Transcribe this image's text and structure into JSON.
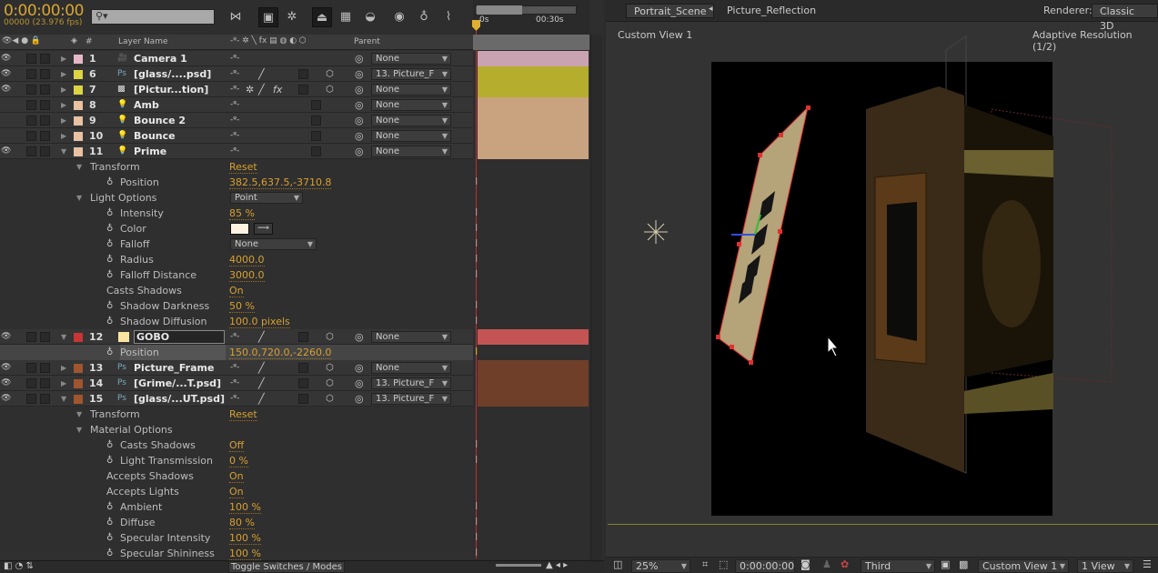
{
  "timeline": {
    "timecode": "0:00:00:00",
    "frame_fps": "00000 (23.976 fps)",
    "search_placeholder": "",
    "ruler_labels": [
      "0s",
      "00:30s"
    ],
    "headers": {
      "layer_name": "Layer Name",
      "number": "#",
      "parent": "Parent"
    },
    "toggle_label": "Toggle Switches / Modes",
    "rows": [
      {
        "type": "layer",
        "num": "1",
        "name": "Camera 1",
        "icon": "camera-icon",
        "color": "#e6b8c8",
        "bar": "#c9a3b1",
        "eye": true,
        "parent": "None",
        "expanded": false
      },
      {
        "type": "layer",
        "num": "6",
        "name": "[glass/....psd]",
        "icon": "psd-icon",
        "color": "#dcd443",
        "bar": "#b5ad2e",
        "eye": true,
        "parent": "13. Picture_F",
        "expanded": false
      },
      {
        "type": "layer",
        "num": "7",
        "name": "[Pictur...tion]",
        "icon": "precomp-icon",
        "color": "#dcd443",
        "bar": "#b5ad2e",
        "eye": true,
        "parent": "None",
        "expanded": false,
        "fx": true
      },
      {
        "type": "layer",
        "num": "8",
        "name": "Amb",
        "icon": "light-icon",
        "color": "#e8c2a2",
        "bar": "#c9a27f",
        "eye": false,
        "parent": "None",
        "expanded": false
      },
      {
        "type": "layer",
        "num": "9",
        "name": "Bounce 2",
        "icon": "light-icon",
        "color": "#e8c2a2",
        "bar": "#c9a27f",
        "eye": false,
        "parent": "None",
        "expanded": false
      },
      {
        "type": "layer",
        "num": "10",
        "name": "Bounce",
        "icon": "light-icon",
        "color": "#e8c2a2",
        "bar": "#c9a27f",
        "eye": false,
        "parent": "None",
        "expanded": false
      },
      {
        "type": "layer",
        "num": "11",
        "name": "Prime",
        "icon": "light-icon",
        "color": "#e8c2a2",
        "bar": "#c9a27f",
        "eye": true,
        "parent": "None",
        "expanded": true
      },
      {
        "type": "group",
        "label": "Transform",
        "value": "Reset"
      },
      {
        "type": "prop",
        "label": "Position",
        "value": "382.5,637.5,-3710.8",
        "kf": true
      },
      {
        "type": "group",
        "label": "Light Options",
        "value": "Point",
        "dropdown": true
      },
      {
        "type": "prop",
        "label": "Intensity",
        "value": "85 %",
        "kf": true
      },
      {
        "type": "prop",
        "label": "Color",
        "value": "",
        "swatch": "#fdf3e0",
        "kf": true
      },
      {
        "type": "prop",
        "label": "Falloff",
        "value": "None",
        "dropdown": true,
        "kf": true
      },
      {
        "type": "prop",
        "label": "Radius",
        "value": "4000.0",
        "kf": true
      },
      {
        "type": "prop",
        "label": "Falloff Distance",
        "value": "3000.0",
        "kf": true
      },
      {
        "type": "prop",
        "label": "Casts Shadows",
        "value": "On",
        "nostop": true
      },
      {
        "type": "prop",
        "label": "Shadow Darkness",
        "value": "50 %",
        "kf": true
      },
      {
        "type": "prop",
        "label": "Shadow Diffusion",
        "value": "100.0 pixels",
        "kf": true
      },
      {
        "type": "layer",
        "num": "12",
        "name": "GOBO",
        "icon": "solid-icon",
        "color": "#c83535",
        "bar": "#c45454",
        "eye": true,
        "parent": "None",
        "expanded": true,
        "editing": true
      },
      {
        "type": "prop",
        "label": "Position",
        "value": "150.0,720.0,-2260.0",
        "kf": true,
        "selected": true
      },
      {
        "type": "layer",
        "num": "13",
        "name": "Picture_Frame",
        "icon": "psd-icon",
        "color": "#a0552e",
        "bar": "#6f3f2a",
        "eye": true,
        "parent": "None",
        "expanded": false
      },
      {
        "type": "layer",
        "num": "14",
        "name": "[Grime/...T.psd]",
        "icon": "psd-icon",
        "color": "#a0552e",
        "bar": "#6f3f2a",
        "eye": true,
        "parent": "13. Picture_F",
        "expanded": false
      },
      {
        "type": "layer",
        "num": "15",
        "name": "[glass/...UT.psd]",
        "icon": "psd-icon",
        "color": "#a0552e",
        "bar": "#6f3f2a",
        "eye": true,
        "parent": "13. Picture_F",
        "expanded": true
      },
      {
        "type": "group",
        "label": "Transform",
        "value": "Reset"
      },
      {
        "type": "group",
        "label": "Material Options",
        "value": ""
      },
      {
        "type": "prop",
        "label": "Casts Shadows",
        "value": "Off",
        "kf": true
      },
      {
        "type": "prop",
        "label": "Light Transmission",
        "value": "0 %",
        "kf": true
      },
      {
        "type": "prop",
        "label": "Accepts Shadows",
        "value": "On",
        "nostop": true
      },
      {
        "type": "prop",
        "label": "Accepts Lights",
        "value": "On",
        "nostop": true
      },
      {
        "type": "prop",
        "label": "Ambient",
        "value": "100 %",
        "kf": true
      },
      {
        "type": "prop",
        "label": "Diffuse",
        "value": "80 %",
        "kf": true
      },
      {
        "type": "prop",
        "label": "Specular Intensity",
        "value": "100 %",
        "kf": true
      },
      {
        "type": "prop",
        "label": "Specular Shininess",
        "value": "100 %",
        "kf": true
      }
    ]
  },
  "viewer": {
    "tabs": [
      "Portrait_Scene",
      "Picture_Reflection"
    ],
    "renderer_label": "Renderer:",
    "renderer": "Classic 3D",
    "view_name": "Custom View 1",
    "resolution": "Adaptive Resolution (1/2)",
    "bottom": {
      "zoom": "25%",
      "timecode": "0:00:00:00",
      "camera": "Third",
      "view": "Custom View 1",
      "layout": "1 View"
    }
  }
}
